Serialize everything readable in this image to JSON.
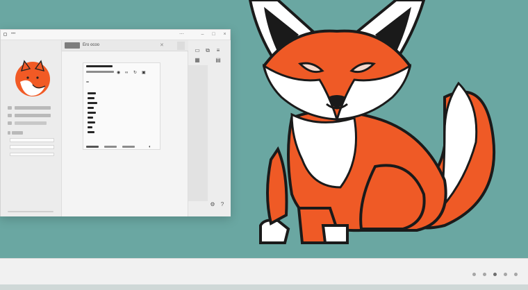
{
  "window": {
    "app_title": "•••",
    "tab_label": "Ero ocoo",
    "tab_close": "✕"
  },
  "colors": {
    "desktop_background": "#6aa7a2",
    "fox_orange": "#ef5a26",
    "fox_outline": "#1a1a1a",
    "fox_white": "#ffffff"
  },
  "icons": {
    "logo": "fox-logo-icon",
    "tools": [
      "image-tool-icon",
      "copy-tool-icon",
      "list-tool-icon",
      "grid-tool-icon",
      "document-tool-icon"
    ]
  }
}
